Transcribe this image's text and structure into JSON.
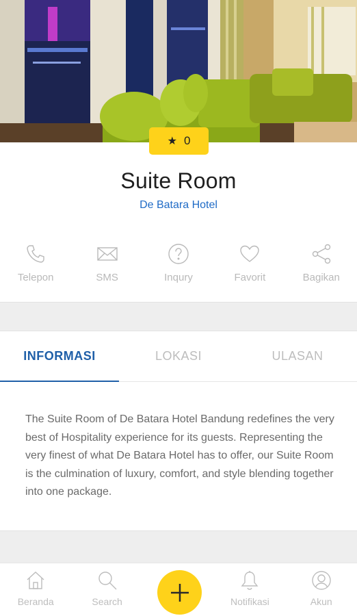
{
  "room": {
    "rating": "0",
    "title": "Suite Room",
    "hotel": "De Batara Hotel"
  },
  "actions": [
    {
      "label": "Telepon",
      "icon": "phone-icon"
    },
    {
      "label": "SMS",
      "icon": "envelope-icon"
    },
    {
      "label": "Inqury",
      "icon": "question-icon"
    },
    {
      "label": "Favorit",
      "icon": "heart-icon"
    },
    {
      "label": "Bagikan",
      "icon": "share-icon"
    }
  ],
  "tabs": [
    {
      "label": "INFORMASI",
      "active": true
    },
    {
      "label": "LOKASI",
      "active": false
    },
    {
      "label": "ULASAN",
      "active": false
    }
  ],
  "description": "The Suite Room of De Batara Hotel Bandung redefines the very best of Hospitality experience for its guests. Representing the very finest of what De Batara Hotel has to offer, our Suite Room is the culmination of luxury, comfort, and style blending together into one package.",
  "bottom_nav": [
    {
      "label": "Beranda",
      "icon": "home-icon"
    },
    {
      "label": "Search",
      "icon": "search-icon"
    },
    {
      "label": "Notifikasi",
      "icon": "bell-icon"
    },
    {
      "label": "Akun",
      "icon": "account-icon"
    }
  ],
  "colors": {
    "accent_yellow": "#fed21a",
    "link_blue": "#1f6bc6",
    "tab_active": "#1f5fa8",
    "muted_gray": "#bdbdbd"
  }
}
